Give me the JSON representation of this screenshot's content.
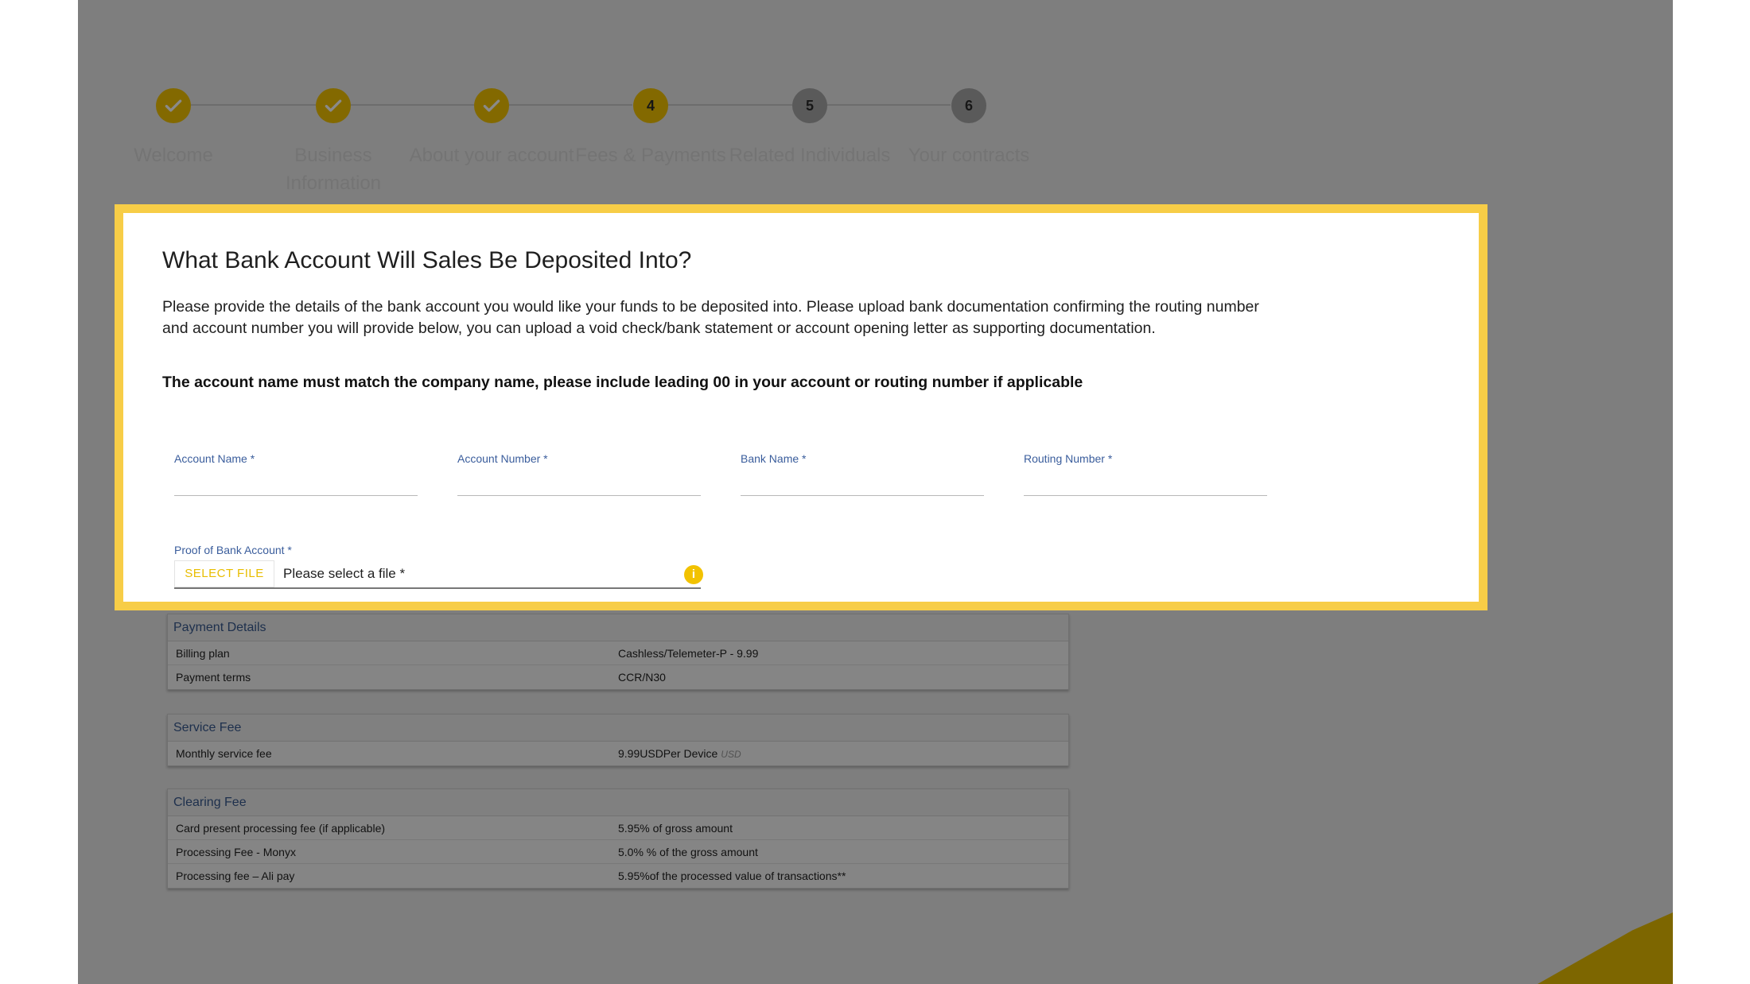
{
  "stepper": {
    "steps": [
      {
        "label": "Welcome",
        "state": "done"
      },
      {
        "label": "Business\nInformation",
        "state": "done"
      },
      {
        "label": "About your account",
        "state": "done"
      },
      {
        "label": "Fees & Payments",
        "state": "active",
        "number": "4"
      },
      {
        "label": "Related Individuals",
        "state": "todo",
        "number": "5"
      },
      {
        "label": "Your contracts",
        "state": "todo",
        "number": "6"
      }
    ]
  },
  "bank_dialog": {
    "title": "What Bank Account Will Sales Be Deposited Into?",
    "description": "Please provide the details of the bank account you would like your funds to be deposited into. Please upload bank documentation confirming the routing number and account number you will provide below, you can upload a void check/bank statement or account opening letter as supporting documentation.",
    "note": "The account name must match the company name, please include leading 00 in your account or routing number if applicable",
    "fields": {
      "account_name": "Account Name *",
      "account_number": "Account Number *",
      "bank_name": "Bank Name *",
      "routing_number": "Routing Number *"
    },
    "proof_label": "Proof of Bank Account *",
    "select_file_label": "SELECT FILE",
    "file_placeholder": "Please select a file *",
    "info_symbol": "i"
  },
  "payment_details": {
    "title": "Payment Details",
    "rows": [
      {
        "label": "Billing plan",
        "value": "Cashless/Telemeter-P - 9.99"
      },
      {
        "label": "Payment terms",
        "value": "CCR/N30"
      }
    ]
  },
  "service_fee": {
    "title": "Service Fee",
    "rows": [
      {
        "label": "Monthly service fee",
        "value": "9.99USDPer Device",
        "unit": "USD"
      }
    ]
  },
  "clearing_fee": {
    "title": "Clearing Fee",
    "rows": [
      {
        "label": "Card present processing fee (if applicable)",
        "value": "5.95% of gross amount"
      },
      {
        "label": "Processing Fee - Monyx",
        "value": "5.0% % of the gross amount"
      },
      {
        "label": "Processing fee – Ali pay",
        "value": "5.95%of the processed value of transactions**"
      }
    ]
  },
  "colors": {
    "accent": "#f2c200",
    "highlight_border": "#f7cd47",
    "label_blue": "#3a5d9c"
  }
}
